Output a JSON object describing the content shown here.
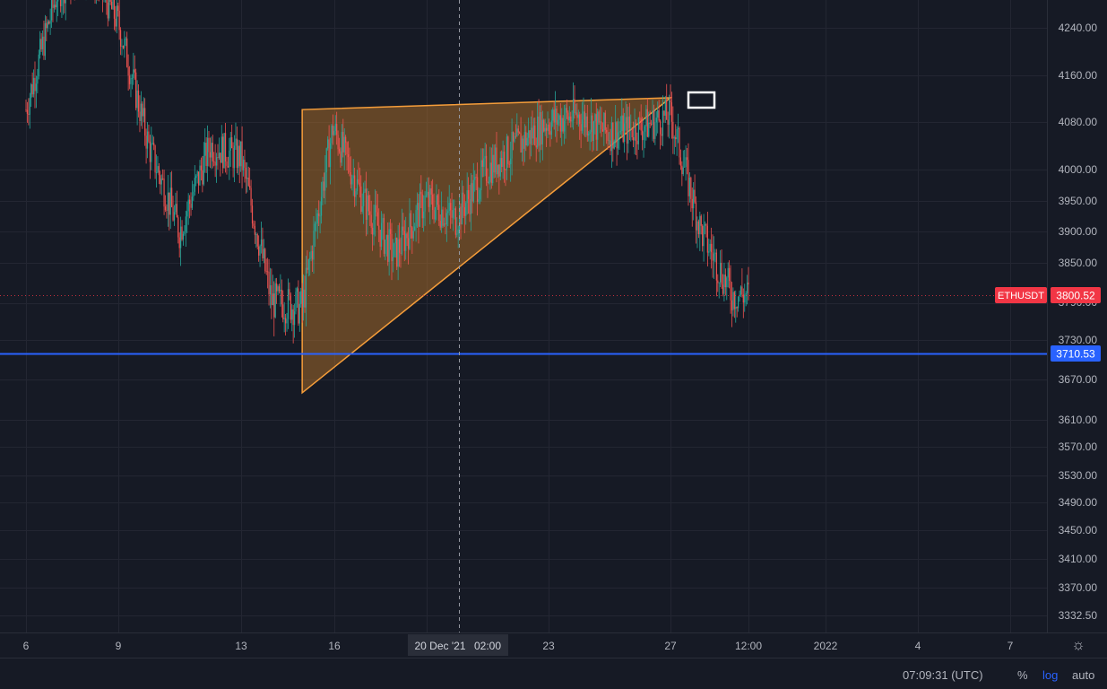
{
  "chart_data": {
    "type": "candlestick",
    "symbol": "ETHUSDT",
    "scale": "log",
    "colors": {
      "up": "#26a69a",
      "down": "#ef5350",
      "triangle_stroke": "#f59d3a",
      "triangle_fill": "#c07a2a",
      "support_line": "#2962ff",
      "last_price_tag": "#f23645",
      "background": "#161a25"
    },
    "price_axis_ticks": [
      "4240.00",
      "4160.00",
      "4080.00",
      "4000.00",
      "3950.00",
      "3900.00",
      "3850.00",
      "3790.00",
      "3730.00",
      "3670.00",
      "3610.00",
      "3570.00",
      "3530.00",
      "3490.00",
      "3450.00",
      "3410.00",
      "3370.00",
      "3332.50"
    ],
    "time_axis_ticks": [
      "6",
      "9",
      "13",
      "16",
      "23",
      "27",
      "12:00",
      "2022",
      "4",
      "7"
    ],
    "crosshair_time_date": "20 Dec '21",
    "crosshair_time_hour": "02:00",
    "last_price": {
      "label": "ETHUSDT",
      "value": "3800.52"
    },
    "support_level": {
      "value": "3710.53"
    },
    "price_path": [
      {
        "day": "Dec 6",
        "price": 4100
      },
      {
        "day": "Dec 7",
        "price": 4300
      },
      {
        "day": "Dec 8",
        "price": 4350
      },
      {
        "day": "Dec 9",
        "price": 4250
      },
      {
        "day": "Dec 10",
        "price": 4040
      },
      {
        "day": "Dec 11",
        "price": 3900
      },
      {
        "day": "Dec 12",
        "price": 4040
      },
      {
        "day": "Dec 13",
        "price": 4020
      },
      {
        "day": "Dec 14",
        "price": 3790
      },
      {
        "day": "Dec 15",
        "price": 3780
      },
      {
        "day": "Dec 16",
        "price": 4070
      },
      {
        "day": "Dec 17",
        "price": 3950
      },
      {
        "day": "Dec 18",
        "price": 3860
      },
      {
        "day": "Dec 19",
        "price": 3950
      },
      {
        "day": "Dec 20",
        "price": 3920
      },
      {
        "day": "Dec 21",
        "price": 4000
      },
      {
        "day": "Dec 22",
        "price": 4040
      },
      {
        "day": "Dec 23",
        "price": 4080
      },
      {
        "day": "Dec 24",
        "price": 4090
      },
      {
        "day": "Dec 25",
        "price": 4060
      },
      {
        "day": "Dec 26",
        "price": 4070
      },
      {
        "day": "Dec 27",
        "price": 4090
      },
      {
        "day": "Dec 28",
        "price": 3900
      },
      {
        "day": "Dec 29",
        "price": 3800
      }
    ],
    "triangle_pattern": {
      "type": "ascending-triangle",
      "points": [
        {
          "day": "Dec 15",
          "price": 4100
        },
        {
          "day": "Dec 15",
          "price": 3650
        },
        {
          "day": "Dec 27",
          "price": 4120
        }
      ]
    },
    "breakout_marker": {
      "day": "Dec 27",
      "price": 4120
    }
  },
  "status": {
    "clock": "07:09:31 (UTC)",
    "percent_label": "%",
    "log_label": "log",
    "auto_label": "auto"
  }
}
